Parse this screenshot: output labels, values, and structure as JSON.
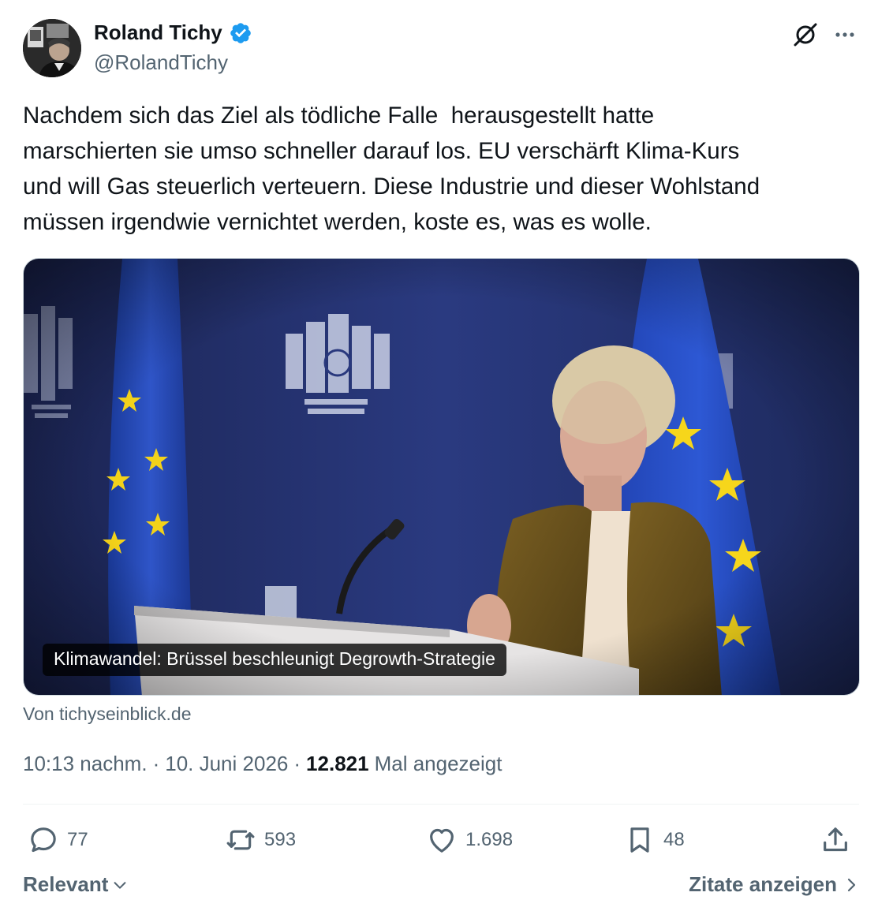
{
  "author": {
    "name": "Roland Tichy",
    "handle": "@RolandTichy",
    "verified": true
  },
  "tweet": {
    "text": "Nachdem sich das Ziel als tödliche Falle  herausgestellt hatte\nmarschierten sie umso schneller darauf los. EU verschärft Klima-Kurs\nund will Gas steuerlich verteuern. Diese Industrie und dieser Wohlstand\nmüssen irgendwie vernichtet werden, koste es, was es wolle."
  },
  "card": {
    "caption": "Klimawandel: Brüssel beschleunigt Degrowth-Strategie",
    "source": "Von tichyseinblick.de"
  },
  "meta": {
    "time": "10:13 nachm.",
    "separator": "·",
    "date": "10. Juni 2026",
    "views_count": "12.821",
    "views_label": "Mal angezeigt"
  },
  "actions": {
    "replies": "77",
    "reposts": "593",
    "likes": "1.698",
    "bookmarks": "48"
  },
  "footer": {
    "sort_label": "Relevant",
    "quotes_label": "Zitate anzeigen"
  },
  "icons": [
    "verified-badge-icon",
    "grok-icon",
    "more-icon",
    "reply-icon",
    "repost-icon",
    "like-icon",
    "bookmark-icon",
    "share-icon",
    "chevron-down-icon",
    "chevron-right-icon"
  ],
  "colors": {
    "text": "#0f1419",
    "secondary": "#536471",
    "verified": "#1d9bf0",
    "divider": "#eff3f4"
  }
}
